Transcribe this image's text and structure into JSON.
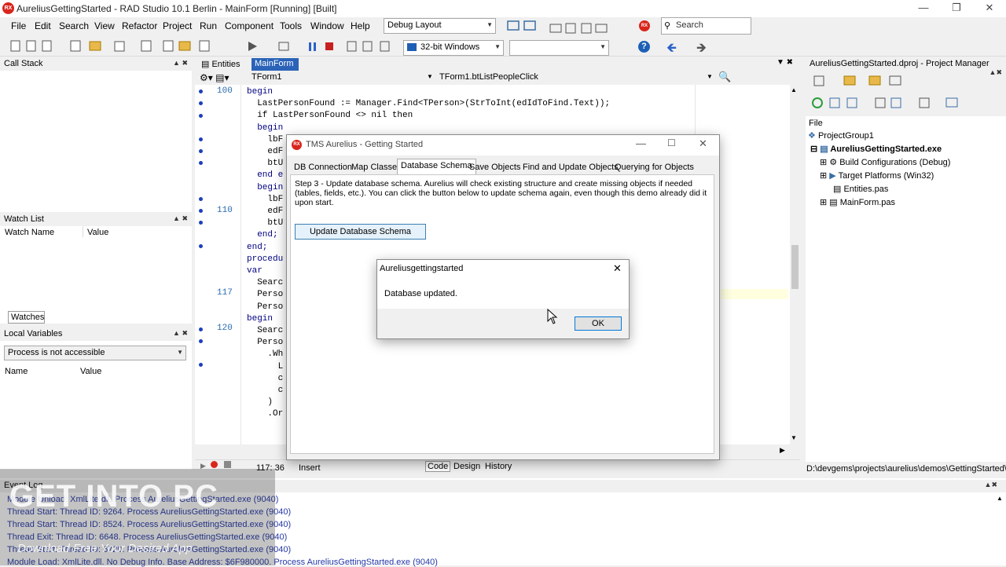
{
  "window": {
    "title": "AureliusGettingStarted - RAD Studio 10.1 Berlin - MainForm [Running] [Built]",
    "logo": "RX"
  },
  "menu": [
    "File",
    "Edit",
    "Search",
    "View",
    "Refactor",
    "Project",
    "Run",
    "Component",
    "Tools",
    "Window",
    "Help"
  ],
  "toolbar": {
    "layout": "Debug Layout",
    "platform": "32-bit Windows",
    "search_placeholder": "Search"
  },
  "left": {
    "call_stack": "Call Stack",
    "watch_list": "Watch List",
    "watch_name": "Watch Name",
    "watch_value": "Value",
    "watches_tab": "Watches",
    "local_vars": "Local Variables",
    "process": "Process is not accessible",
    "name_col": "Name",
    "value_col": "Value"
  },
  "editor": {
    "tabs": [
      "Entities",
      "MainForm"
    ],
    "class_combo": "TForm1",
    "method_combo": "TForm1.btListPeopleClick",
    "line_numbers": [
      "100",
      "110",
      "117",
      "120"
    ],
    "lines": [
      "begin",
      "  LastPersonFound := Manager.Find<TPerson>(StrToInt(edIdToFind.Text));",
      "  if LastPersonFound <> nil then",
      "  begin",
      "    lbF",
      "    edF",
      "    btU",
      "  end e",
      "  begin",
      "    lbF",
      "    edF",
      "    btU",
      "  end;",
      "end;",
      "",
      "procedu",
      "var",
      "  Searc",
      "  Perso",
      "  Perso",
      "begin",
      "  Searc",
      "",
      "  Perso",
      "    .Wh",
      "      L",
      "      c",
      "      c",
      "    )",
      "    .Or"
    ],
    "status_pos": "117: 36",
    "status_mode": "Insert",
    "bottom_tabs": [
      "Code",
      "Design",
      "History"
    ]
  },
  "project": {
    "title": "AureliusGettingStarted.dproj - Project Manager",
    "file_label": "File",
    "items": [
      "ProjectGroup1",
      "AureliusGettingStarted.exe",
      "Build Configurations (Debug)",
      "Target Platforms (Win32)",
      "Entities.pas",
      "MainForm.pas"
    ],
    "path": "D:\\devgems\\projects\\aurelius\\demos\\GettingStarted\\"
  },
  "app_window": {
    "title": "TMS Aurelius - Getting Started",
    "tabs": [
      "DB Connection",
      "Map Classes",
      "Database Schema",
      "Save Objects",
      "Find and Update Objects",
      "Querying for Objects"
    ],
    "step_text": "Step 3 - Update database schema. Aurelius will check existing structure and create missing objects if needed (tables, fields, etc.). You can click the button below to update schema again, even though this demo already did it upon start.",
    "update_button": "Update Database Schema"
  },
  "message_box": {
    "title": "Aureliusgettingstarted",
    "message": "Database updated.",
    "ok": "OK"
  },
  "event_log": {
    "title": "Event Log",
    "lines": [
      "Module Unload: XmlLite.dll. Process AureliusGettingStarted.exe (9040)",
      "Thread Start: Thread ID: 9264. Process AureliusGettingStarted.exe (9040)",
      "Thread Start: Thread ID: 8524. Process AureliusGettingStarted.exe (9040)",
      "Thread Exit: Thread ID: 6648. Process AureliusGettingStarted.exe (9040)",
      "Thread Start: Thread ID: 6720. Process AureliusGettingStarted.exe (9040)",
      "Module Load: XmlLite.dll. No Debug Info. Base Address: $6F980000. Process AureliusGettingStarted.exe (9040)"
    ]
  },
  "watermark": {
    "main": "GET INTO PC",
    "sub": "Download Free Your Desired App"
  }
}
